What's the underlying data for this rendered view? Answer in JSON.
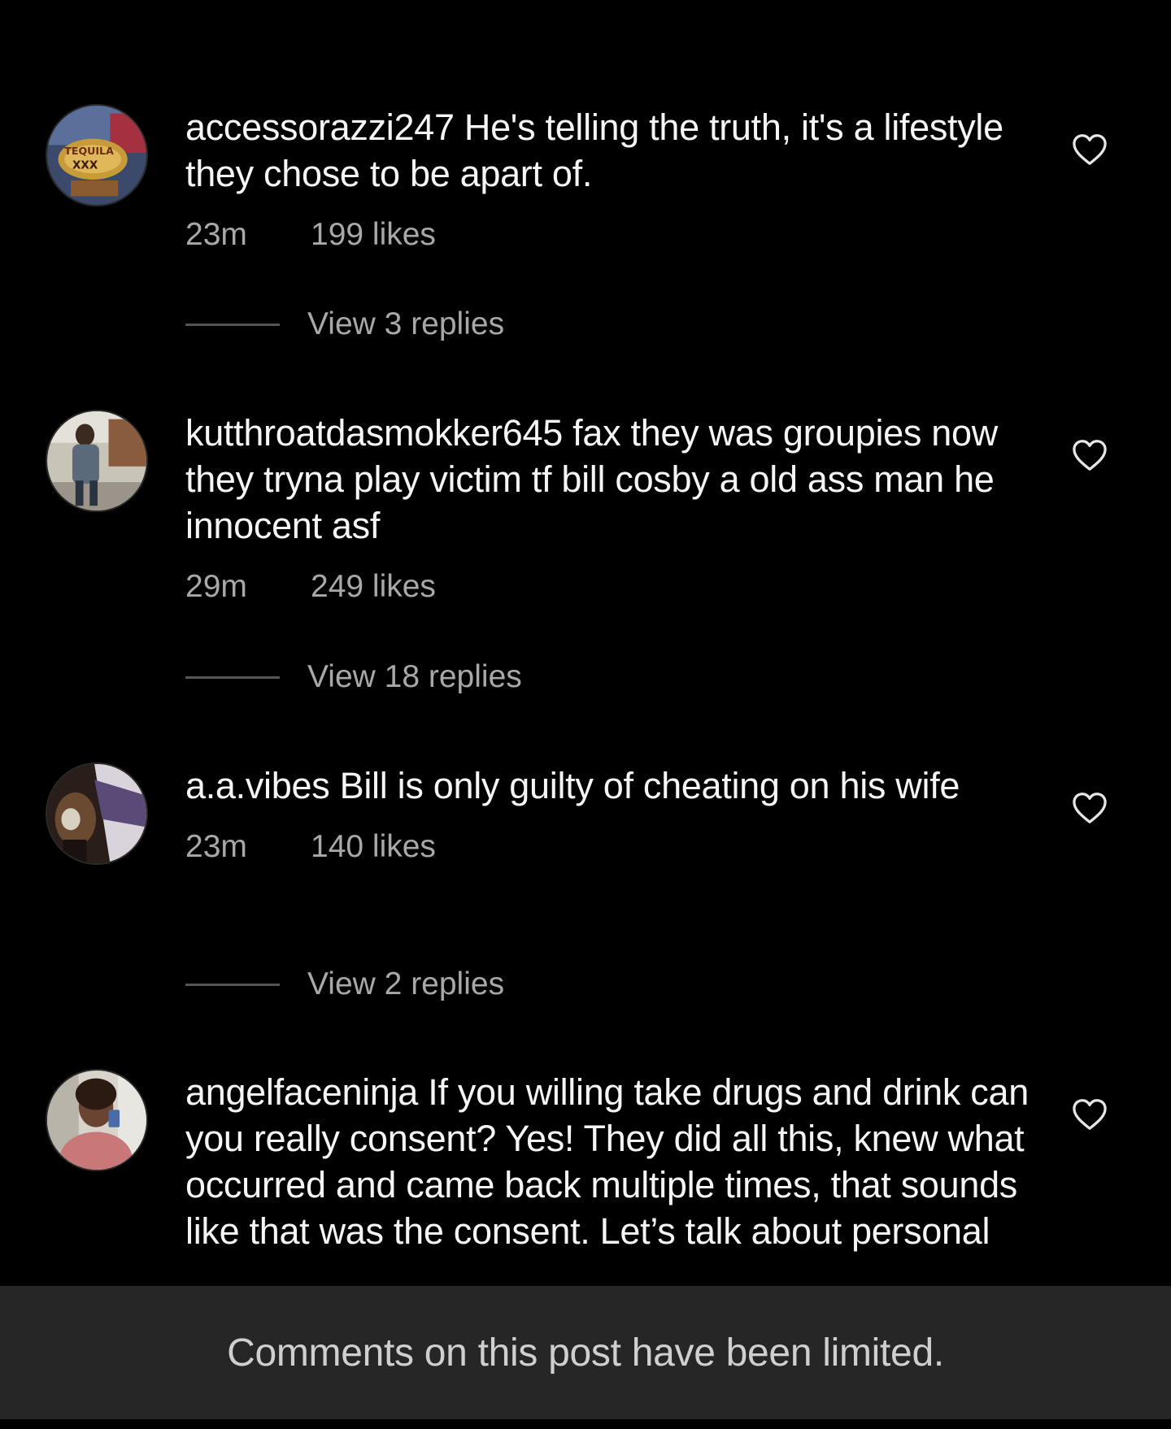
{
  "comments": [
    {
      "username": "accessorazzi247",
      "text": "He's telling the truth,  it's a lifestyle they chose to be apart of.",
      "time": "23m",
      "likes": "199 likes",
      "replies_label": "View 3 replies",
      "avatar_icon": "avatar-tequila-photo"
    },
    {
      "username": "kutthroatdasmokker645",
      "text": "fax they was groupies now they tryna play victim tf bill cosby a old ass man he innocent asf",
      "time": "29m",
      "likes": "249 likes",
      "replies_label": "View 18 replies",
      "avatar_icon": "avatar-street-photo"
    },
    {
      "username": "a.a.vibes",
      "text": "Bill is only guilty of cheating on his wife",
      "time": "23m",
      "likes": "140 likes",
      "replies_label": "View 2 replies",
      "avatar_icon": "avatar-drink-photo"
    },
    {
      "username": "angelfaceninja",
      "text": "If you willing take drugs and drink can you really consent? Yes! They did all this, knew what occurred and came back multiple times, that sounds like that was the consent. Let’s talk about personal",
      "avatar_icon": "avatar-selfie-photo"
    }
  ],
  "footer": {
    "notice": "Comments on this post have been limited."
  },
  "colors": {
    "background": "#000000",
    "text": "#f5f5f5",
    "secondary_text": "#a8a8a8",
    "footer_background": "#262626"
  },
  "icons": {
    "like": "heart-outline-icon"
  }
}
